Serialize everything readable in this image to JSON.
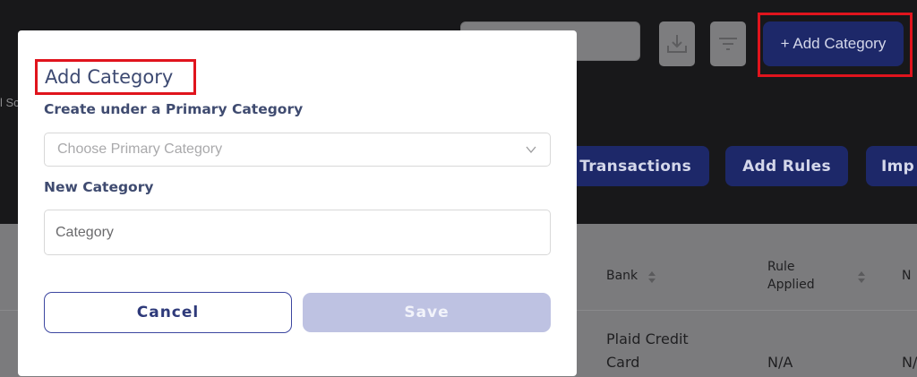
{
  "header": {
    "add_category_label": "+ Add Category",
    "partial_text": "l Sc"
  },
  "actions": {
    "transactions_label": "Transactions",
    "add_rules_label": "Add Rules",
    "import_label": "Imp"
  },
  "table": {
    "headers": {
      "bank": "Bank",
      "rule_applied_line1": "Rule",
      "rule_applied_line2": "Applied",
      "next_partial": "N"
    },
    "rows": [
      {
        "bank_line1": "Plaid Credit",
        "bank_line2": "Card",
        "rule_applied": "N/A",
        "next_partial": "N/"
      }
    ]
  },
  "modal": {
    "title": "Add Category",
    "primary_label": "Create under a Primary Category",
    "primary_placeholder": "Choose Primary Category",
    "new_category_label": "New Category",
    "category_placeholder": "Category",
    "cancel_label": "Cancel",
    "save_label": "Save"
  },
  "colors": {
    "accent": "#1d2869",
    "highlight": "#e0141d",
    "save_disabled": "#bec2e2",
    "title_text": "#3d4a72"
  }
}
